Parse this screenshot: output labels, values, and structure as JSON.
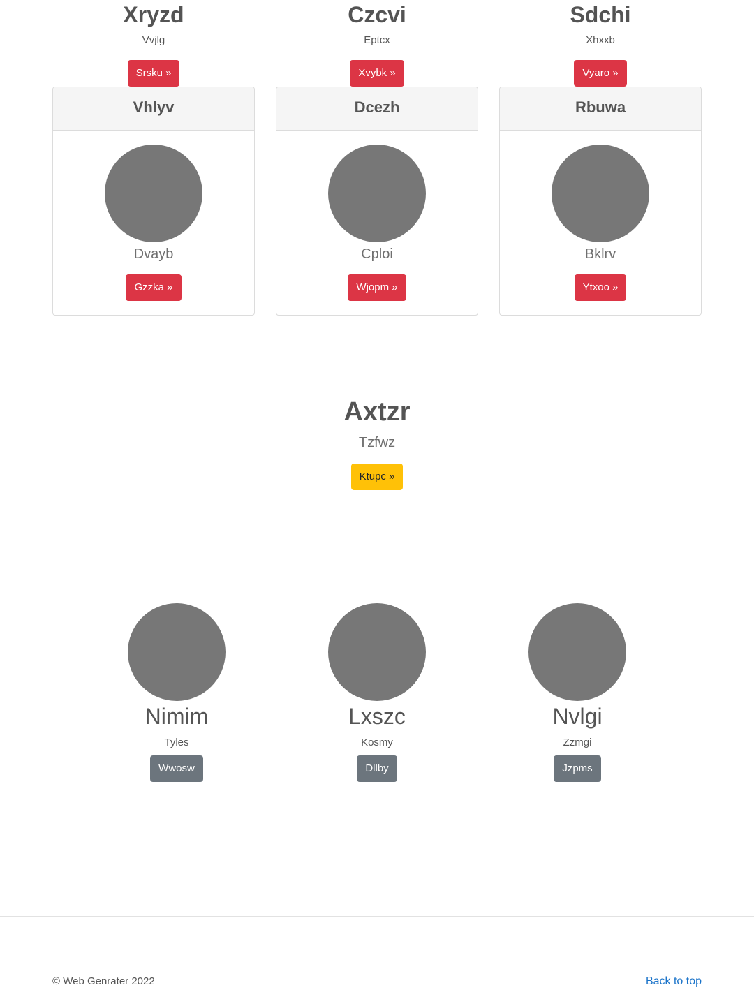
{
  "top_features": [
    {
      "title": "Xryzd",
      "subtitle": "Vvjlg",
      "button": "Srsku »"
    },
    {
      "title": "Czcvi",
      "subtitle": "Eptcx",
      "button": "Xvybk »"
    },
    {
      "title": "Sdchi",
      "subtitle": "Xhxxb",
      "button": "Vyaro »"
    }
  ],
  "cards": [
    {
      "header": "Vhlyv",
      "subtitle": "Dvayb",
      "button": "Gzzka »"
    },
    {
      "header": "Dcezh",
      "subtitle": "Cploi",
      "button": "Wjopm »"
    },
    {
      "header": "Rbuwa",
      "subtitle": "Bklrv",
      "button": "Ytxoo »"
    }
  ],
  "hero": {
    "title": "Axtzr",
    "subtitle": "Tzfwz",
    "button": "Ktupc »"
  },
  "people": [
    {
      "name": "Nimim",
      "subtitle": "Tyles",
      "button": "Wwosw"
    },
    {
      "name": "Lxszc",
      "subtitle": "Kosmy",
      "button": "Dllby"
    },
    {
      "name": "Nvlgi",
      "subtitle": "Zzmgi",
      "button": "Jzpms"
    }
  ],
  "footer": {
    "copyright": "© Web Genrater 2022",
    "back_to_top": "Back to top"
  },
  "colors": {
    "danger": "#dc3545",
    "warning": "#ffc107",
    "secondary": "#6c757d",
    "avatar": "#777777",
    "link": "#1a73c9"
  }
}
